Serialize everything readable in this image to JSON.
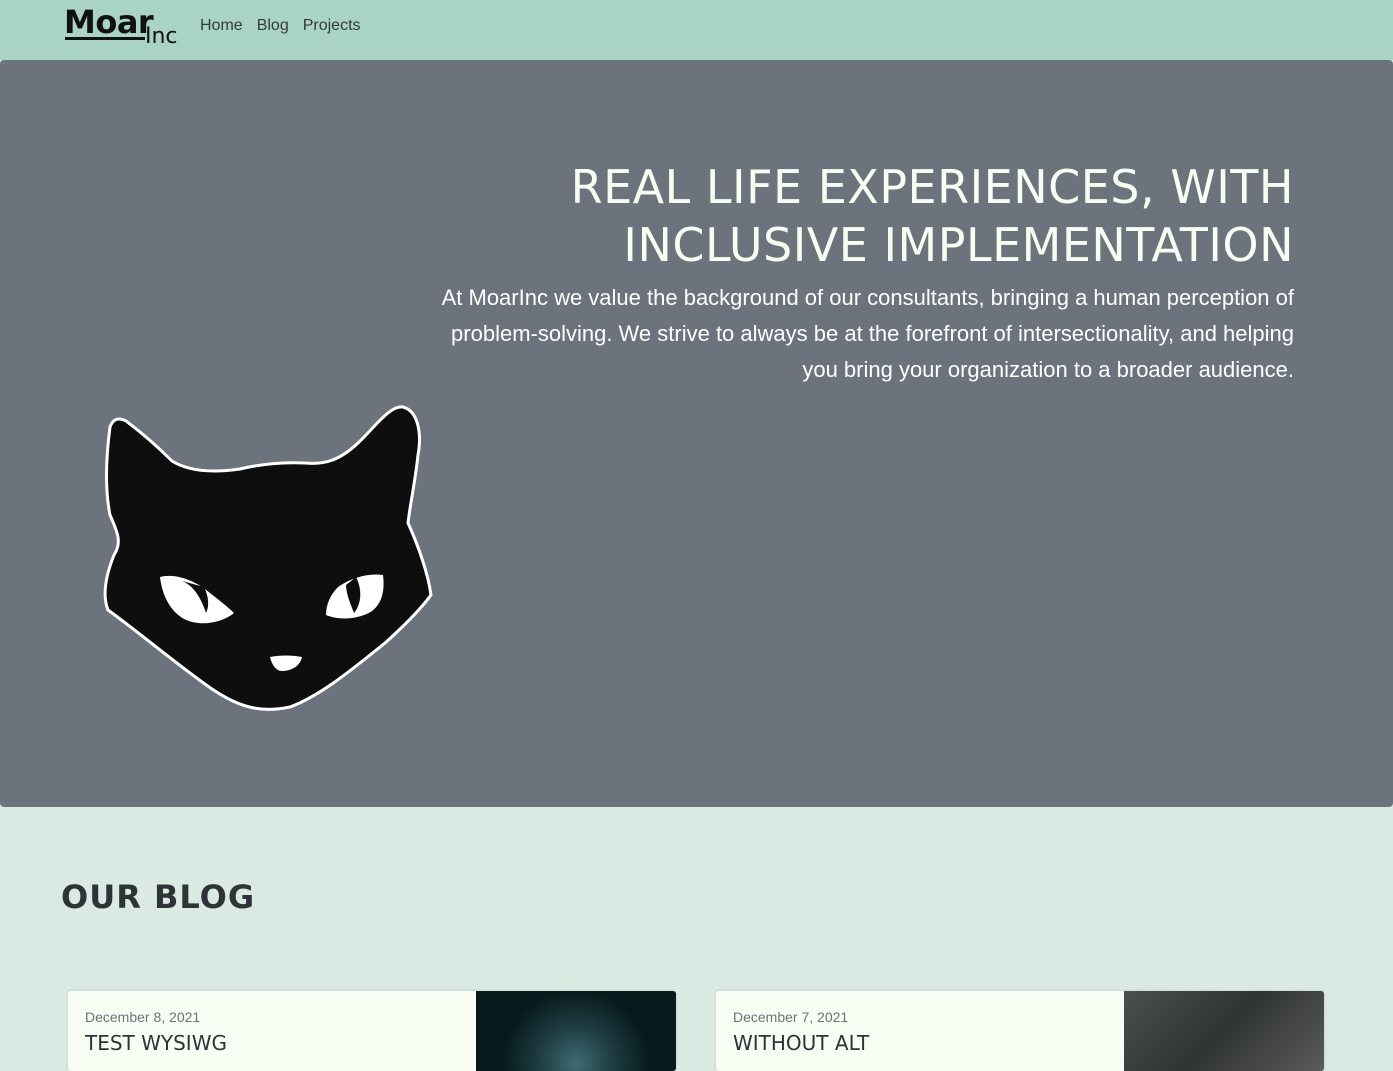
{
  "nav": {
    "logo_main": "Moar",
    "logo_sub": "Inc",
    "links": [
      "Home",
      "Blog",
      "Projects"
    ]
  },
  "hero": {
    "title": "REAL LIFE EXPERIENCES, WITH INCLUSIVE IMPLEMENTATION",
    "text": "At MoarInc we value the background of our consultants, bringing a human perception of problem-solving. We strive to always be at the forefront of intersectionality, and helping you bring your organization to a broader audience."
  },
  "blog": {
    "heading": "OUR BLOG",
    "posts": [
      {
        "date": "December 8, 2021",
        "title": "TEST WYSIWG"
      },
      {
        "date": "December 7, 2021",
        "title": "WITHOUT ALT"
      }
    ]
  },
  "colors": {
    "navbar": "#a9d3c2",
    "hero": "#6c737d",
    "page": "#dae9e1"
  }
}
